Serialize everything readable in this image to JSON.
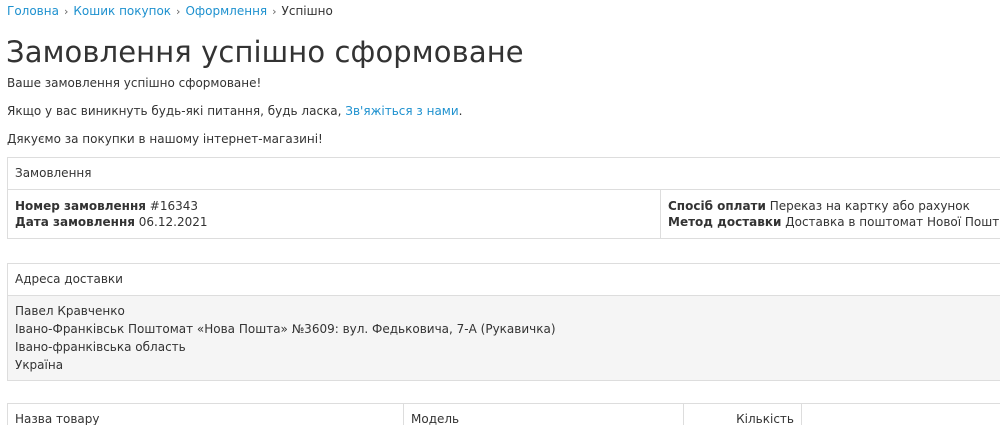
{
  "breadcrumb": {
    "items": [
      "Головна",
      "Кошик покупок",
      "Оформлення"
    ],
    "current": "Успішно",
    "separator": "›"
  },
  "title": "Замовлення успішно сформоване",
  "messages": {
    "line1": "Ваше замовлення успішно сформоване!",
    "line2_prefix": "Якщо у вас виникнуть будь-які питання, будь ласка, ",
    "line2_link": "Зв'яжіться з нами",
    "line2_suffix": ".",
    "line3": "Дякуємо за покупки в нашому інтернет-магазині!"
  },
  "order": {
    "header": "Замовлення",
    "number_label": "Номер замовлення",
    "number_value": "#16343",
    "date_label": "Дата замовлення",
    "date_value": "06.12.2021",
    "payment_label": "Спосіб оплати",
    "payment_value": "Переказ на картку або рахунок",
    "shipping_label": "Метод доставки",
    "shipping_value": "Доставка в поштомат Нової Пошти"
  },
  "address": {
    "header": "Адреса доставки",
    "lines": [
      "Павел Кравченко",
      "Івано-Франківськ Поштомат «Нова Пошта» №3609: вул. Федьковича, 7-А (Рукавичка)",
      "Івано-франківська область",
      "Україна"
    ]
  },
  "products": {
    "columns": [
      "Назва товару",
      "Модель",
      "Кількість",
      ""
    ]
  }
}
